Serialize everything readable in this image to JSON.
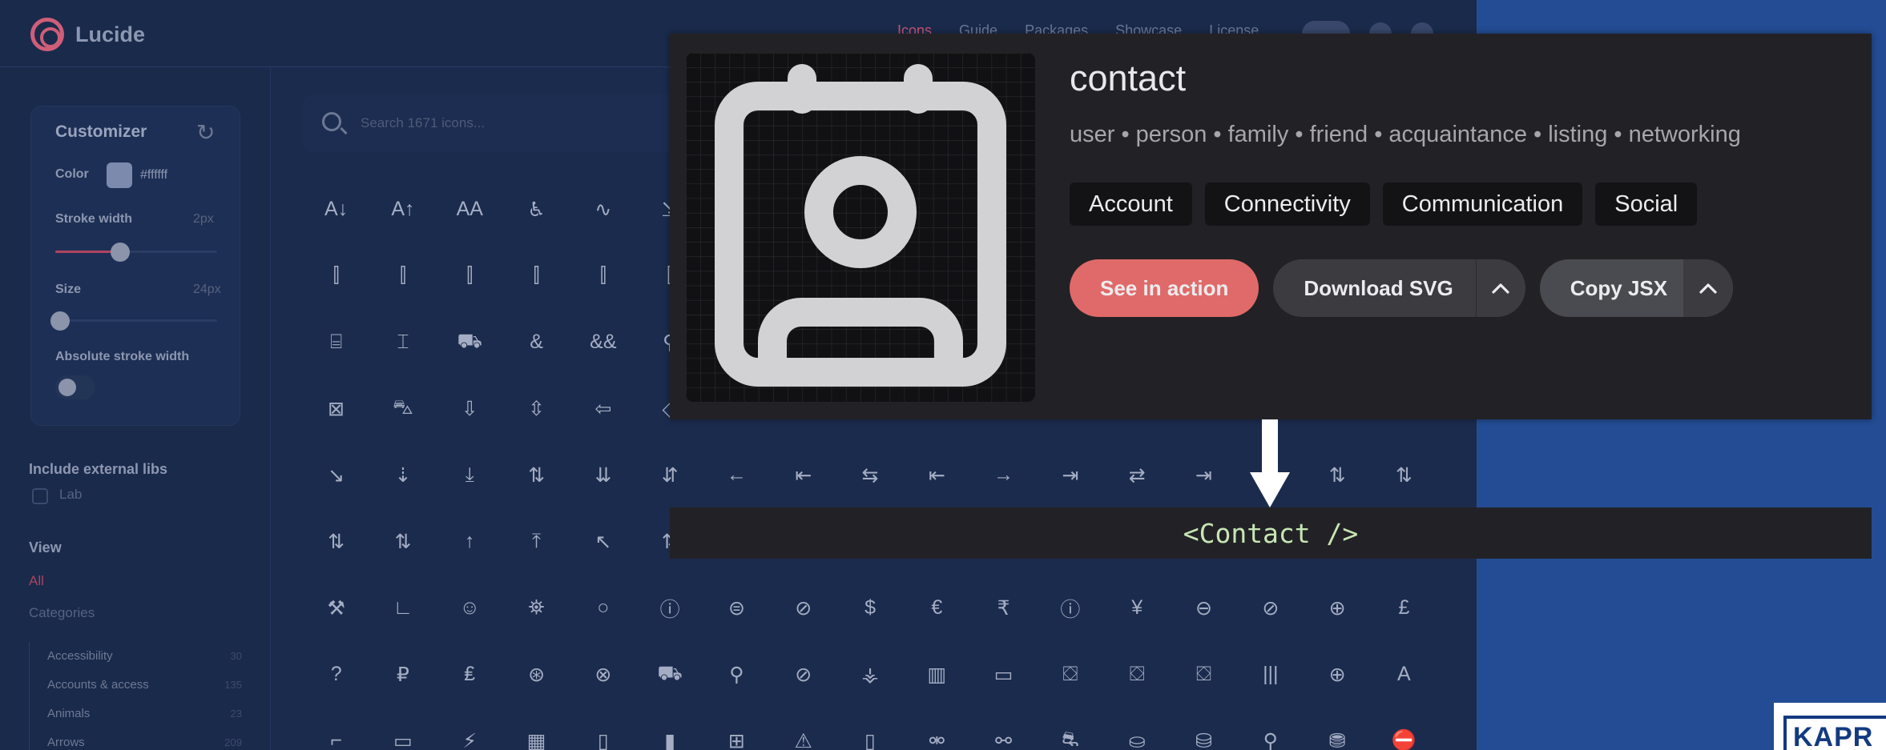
{
  "site": {
    "logo": "Lucide",
    "nav": [
      "Icons",
      "Guide",
      "Packages",
      "Showcase",
      "License"
    ],
    "search_placeholder": "Search 1671 icons...",
    "customizer": {
      "title": "Customizer",
      "color_label": "Color",
      "color_value": "#ffffff",
      "stroke_width_label": "Stroke width",
      "stroke_width_value": "2px",
      "stroke_width_level": 0.4,
      "size_label": "Size",
      "size_value": "24px",
      "size_level": 0.0,
      "absolute_stroke_label": "Absolute stroke width"
    },
    "sidebar": {
      "external_libs_label": "Include external libs",
      "lab_label": "Lab",
      "view_label": "View",
      "all_label": "All",
      "categories_label": "Categories",
      "categories": [
        {
          "name": "Accessibility",
          "count": "30"
        },
        {
          "name": "Accounts & access",
          "count": "135"
        },
        {
          "name": "Animals",
          "count": "23"
        },
        {
          "name": "Arrows",
          "count": "209"
        }
      ]
    },
    "icon_rows": [
      [
        "A↓",
        "A↑",
        "AA",
        "♿",
        "∿",
        "⇲"
      ],
      [
        "⫿",
        "⫿",
        "⫿",
        "⫿",
        "⫿",
        "⫿"
      ],
      [
        "⌸",
        "⌶",
        "⛟",
        "&",
        "&&",
        "⚲"
      ],
      [
        "⊠",
        "⛍",
        "⇩",
        "⇳",
        "⇦",
        "◇"
      ],
      [
        "↘",
        "⇣",
        "⤓",
        "⇅",
        "⇊",
        "⇵",
        "←",
        "⇤",
        "⇆",
        "⇤",
        "→",
        "⇥",
        "⇄",
        "⇥",
        "⇵",
        "⇅",
        "⇅"
      ],
      [
        "⇅",
        "⇅",
        "↑",
        "⤒",
        "↖",
        "⇅"
      ],
      [
        "⚒",
        "∟",
        "☺",
        "⛯",
        "○",
        "ⓘ",
        "⊜",
        "⊘",
        "$",
        "€",
        "₹",
        "ⓘ",
        "¥",
        "⊖",
        "⊘",
        "⊕",
        "£"
      ],
      [
        "?",
        "₽",
        "₤",
        "⊛",
        "⊗",
        "⛟",
        "⚲",
        "⊘",
        "⚶",
        "▥",
        "▭",
        "⛋",
        "⛋",
        "⛋",
        "|||",
        "⊕",
        "A"
      ],
      [
        "⌐",
        "▭",
        "⚡",
        "▦",
        "▯",
        "▮",
        "⊞",
        "⚠",
        "▯",
        "⚮",
        "⚯",
        "⛐",
        "⛀",
        "⛁",
        "⚲",
        "⛃",
        "⛔"
      ]
    ]
  },
  "panel": {
    "icon_name": "contact",
    "tags": "user • person • family • friend • acquaintance • listing • networking",
    "categories": [
      "Account",
      "Connectivity",
      "Communication",
      "Social"
    ],
    "primary_button": "See in action",
    "download_button": "Download SVG",
    "copy_button": "Copy JSX",
    "chevron": "^"
  },
  "code": "<Contact />",
  "watermark": "KAPR"
}
